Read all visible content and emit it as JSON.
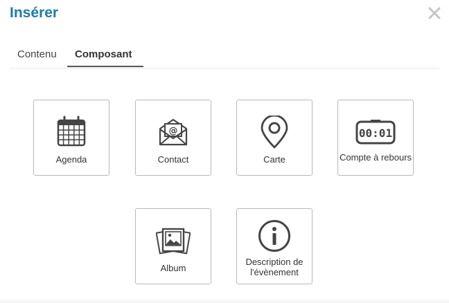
{
  "dialog": {
    "title": "Insérer",
    "close_icon": "close-icon"
  },
  "tabs": [
    {
      "label": "Contenu",
      "active": false
    },
    {
      "label": "Composant",
      "active": true
    }
  ],
  "components": [
    {
      "label": "Agenda",
      "icon": "calendar-icon"
    },
    {
      "label": "Contact",
      "icon": "email-icon"
    },
    {
      "label": "Carte",
      "icon": "map-pin-icon"
    },
    {
      "label": "Compte à rebours",
      "icon": "countdown-icon",
      "icon_text": "00:01"
    },
    {
      "label": "Album",
      "icon": "photo-album-icon"
    },
    {
      "label_line1": "Description de",
      "label_line2": "l'évènement",
      "icon": "info-icon"
    }
  ],
  "colors": {
    "title": "#1c7ba7",
    "icon": "#444444",
    "tile_border": "#b8b8b8"
  }
}
